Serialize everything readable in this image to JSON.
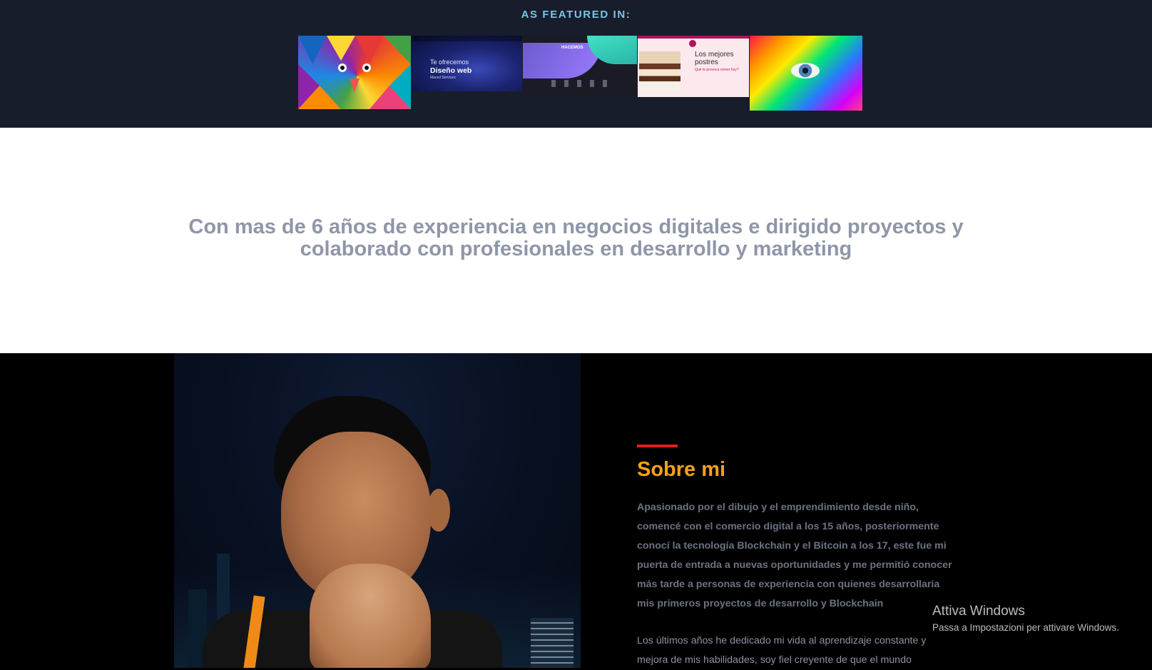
{
  "featured": {
    "title": "AS FEATURED IN:",
    "thumbnails": [
      {
        "name": "colorful-mural",
        "caption": ""
      },
      {
        "name": "web-design",
        "caption_line1": "Te ofrecemos",
        "caption_line2": "Diseño web",
        "caption_line3": "Maced Services"
      },
      {
        "name": "hacemos-site",
        "caption": "HACEMOS"
      },
      {
        "name": "postres-site",
        "caption_line1": "Los mejores",
        "caption_line2": "postres",
        "caption_line3": "Qué te provoca comer hoy?"
      },
      {
        "name": "rainbow-face",
        "caption": ""
      }
    ]
  },
  "headline": {
    "text": "Con mas de 6 años de experiencia en negocios digitales e dirigido proyectos y colaborado con profesionales en desarrollo y marketing"
  },
  "about": {
    "title": "Sobre mi",
    "paragraph1": "Apasionado por el dibujo y el emprendimiento desde niño, comencé con el comercio digital a los 15 años, posteriormente conocí la tecnología Blockchain y el Bitcoin a los 17, este fue mi puerta de entrada a nuevas oportunidades y me permitió conocer más tarde a personas de experiencia con quienes desarrollaria mis primeros proyectos de desarrollo y Blockchain",
    "paragraph2": "Los últimos años he dedicado mi vida al aprendizaje constante y mejora de mis habilidades, soy fiel creyente de que el mundo"
  },
  "watermark": {
    "title": "Attiva Windows",
    "subtitle": "Passa a Impostazioni per attivare Windows."
  },
  "colors": {
    "featured_bg": "#171d2b",
    "featured_title": "#7fc3e4",
    "headline_text": "#8f96a8",
    "accent_red": "#e11d1d",
    "about_title": "#f7a11a",
    "about_text": "#6c7282"
  }
}
